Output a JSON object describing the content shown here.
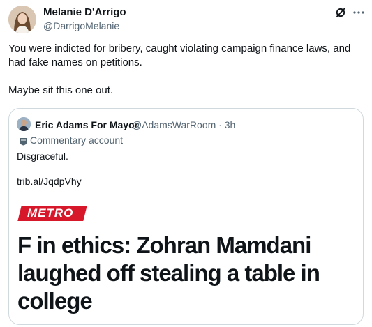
{
  "post": {
    "author_name": "Melanie D'Arrigo",
    "author_handle": "@DarrigoMelanie",
    "text_line1": "You were indicted for bribery, caught violating campaign finance laws, and had fake names on petitions.",
    "text_line2": "Maybe sit this one out.",
    "icons": [
      "grok-icon",
      "more-icon"
    ]
  },
  "quote": {
    "author_name": "Eric Adams For Mayor",
    "author_handle": "@AdamsWarRoom · 3h",
    "account_label": "Commentary account",
    "text": "Disgraceful.",
    "link": "trib.al/JqdpVhy",
    "media": {
      "badge": "METRO",
      "headline": "F in ethics: Zohran Mamdani laughed off stealing a table in college"
    }
  },
  "colors": {
    "text": "#0f1419",
    "secondary": "#536471",
    "border": "#cfd9de",
    "metro_red": "#d6182a"
  }
}
